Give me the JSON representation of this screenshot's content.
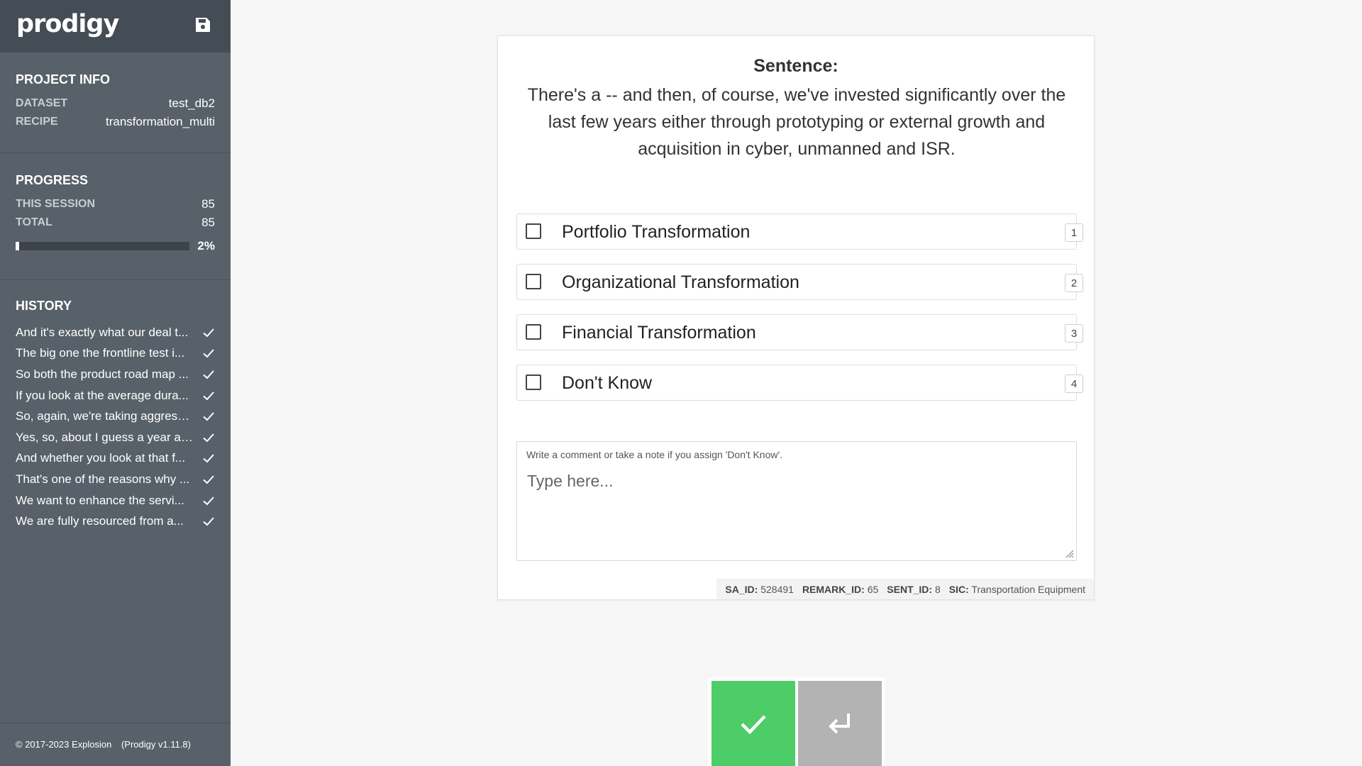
{
  "app": {
    "name": "prodigy"
  },
  "sidebar": {
    "project_info": {
      "title": "Project Info",
      "dataset_label": "Dataset",
      "dataset_value": "test_db2",
      "recipe_label": "Recipe",
      "recipe_value": "transformation_multi"
    },
    "progress": {
      "title": "Progress",
      "session_label": "This Session",
      "session_value": "85",
      "total_label": "Total",
      "total_value": "85",
      "percent_text": "2%",
      "fraction": 0.02
    },
    "history": {
      "title": "History",
      "items": [
        "And it's exactly what our deal t...",
        "The big one the frontline test i...",
        "So both the product road map ...",
        "If you look at the average dura...",
        "So, again, we're taking aggressi...",
        "Yes, so, about I guess a year an...",
        "And whether you look at that f...",
        "That's one of the reasons why ...",
        "We want to enhance the servi...",
        "We are fully resourced from a..."
      ]
    },
    "footer": {
      "copyright": "© 2017-2023 Explosion",
      "version": "(Prodigy v1.11.8)"
    }
  },
  "card": {
    "sentence_label": "Sentence:",
    "sentence_text": "There's a -- and then, of course, we've invested significantly over the last few years either through prototyping or external growth and acquisition in cyber, unmanned and ISR.",
    "options": [
      {
        "label": "Portfolio Transformation",
        "key": "1"
      },
      {
        "label": "Organizational Transformation",
        "key": "2"
      },
      {
        "label": "Financial Transformation",
        "key": "3"
      },
      {
        "label": "Don't Know",
        "key": "4"
      }
    ],
    "comment": {
      "hint": "Write a comment or take a note if you assign 'Don't Know'.",
      "placeholder": "Type here..."
    },
    "meta": {
      "sa_id_label": "SA_ID:",
      "sa_id": "528491",
      "remark_id_label": "REMARK_ID:",
      "remark_id": "65",
      "sent_id_label": "SENT_ID:",
      "sent_id": "8",
      "sic_label": "SIC:",
      "sic": "Transportation Equipment"
    }
  },
  "colors": {
    "accept": "#4ccd68",
    "undo": "#b3b3b3",
    "sidebar": "#586069",
    "header": "#444c55"
  },
  "icons": {
    "save": "save-icon",
    "accept": "check-icon",
    "undo": "undo-return-icon",
    "history_status": "check-icon"
  }
}
